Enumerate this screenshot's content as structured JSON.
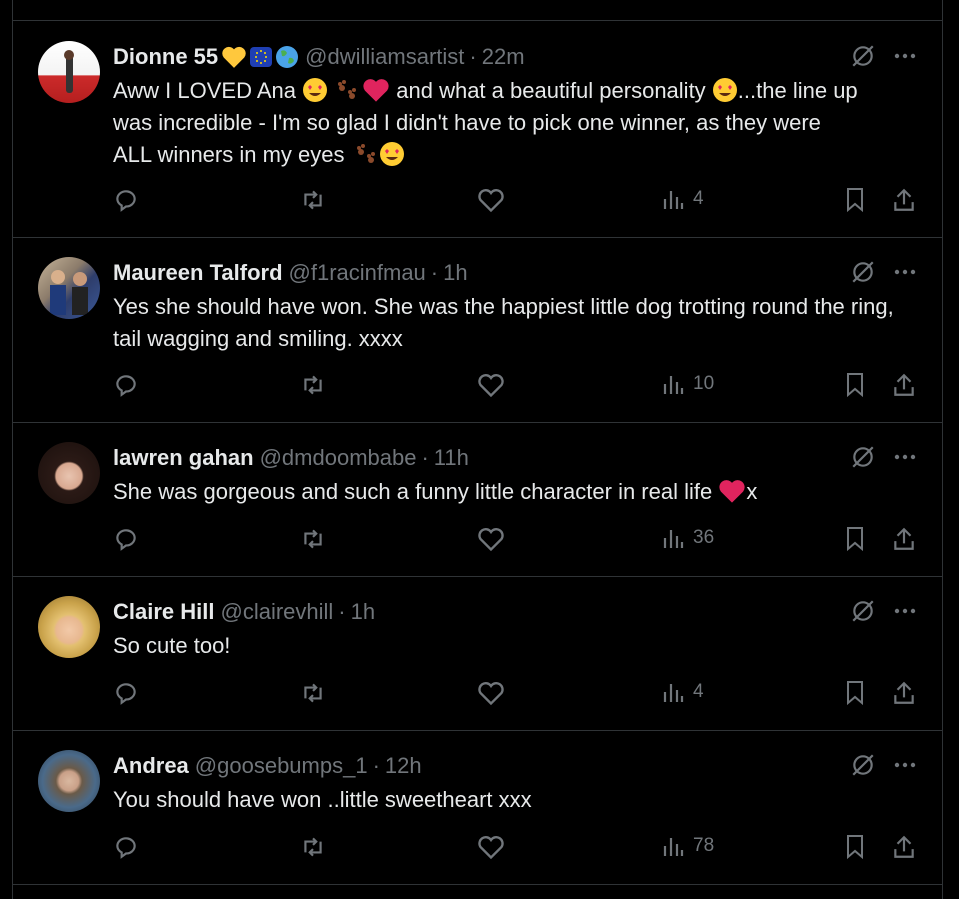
{
  "replies": [
    {
      "name": "Dionne 55",
      "badges": [
        "yellow-heart",
        "eu-flag",
        "globe"
      ],
      "handle": "@dwilliamsartist",
      "separator": "·",
      "time": "22m",
      "text_line1_a": "Aww I LOVED Ana ",
      "text_line1_b": " and what a beautiful personality ",
      "text_line1_c": "...the line up",
      "text_line2": "was incredible - I'm so glad I didn't have to pick one winner, as they were",
      "text_line3": "ALL winners in my eyes ",
      "views": "4"
    },
    {
      "name": "Maureen Talford",
      "handle": "@f1racinfmau",
      "separator": "·",
      "time": "1h",
      "text": "Yes she should have won. She was the happiest little dog trotting round the ring, tail wagging and smiling. xxxx",
      "views": "10"
    },
    {
      "name": "lawren gahan",
      "handle": "@dmdoombabe",
      "separator": "·",
      "time": "11h",
      "text_a": "She was gorgeous and such a funny little character in real life ",
      "text_b": "x",
      "views": "36"
    },
    {
      "name": "Claire Hill",
      "handle": "@clairevhill",
      "separator": "·",
      "time": "1h",
      "text": "So cute too!",
      "views": "4"
    },
    {
      "name": "Andrea",
      "handle": "@goosebumps_1",
      "separator": "·",
      "time": "12h",
      "text": "You should have won ..little sweetheart xxx",
      "views": "78"
    }
  ],
  "icons": {
    "reply": "reply-icon",
    "repost": "repost-icon",
    "like": "heart-icon",
    "views": "views-icon",
    "bookmark": "bookmark-icon",
    "share": "share-icon",
    "grok": "grok-icon",
    "more": "more-icon"
  },
  "colors": {
    "background": "#000000",
    "text": "#e7e9ea",
    "muted": "#71767b",
    "divider": "#2f3336",
    "heart_emoji": "#e0245e",
    "smiley": "#ffcc33"
  }
}
